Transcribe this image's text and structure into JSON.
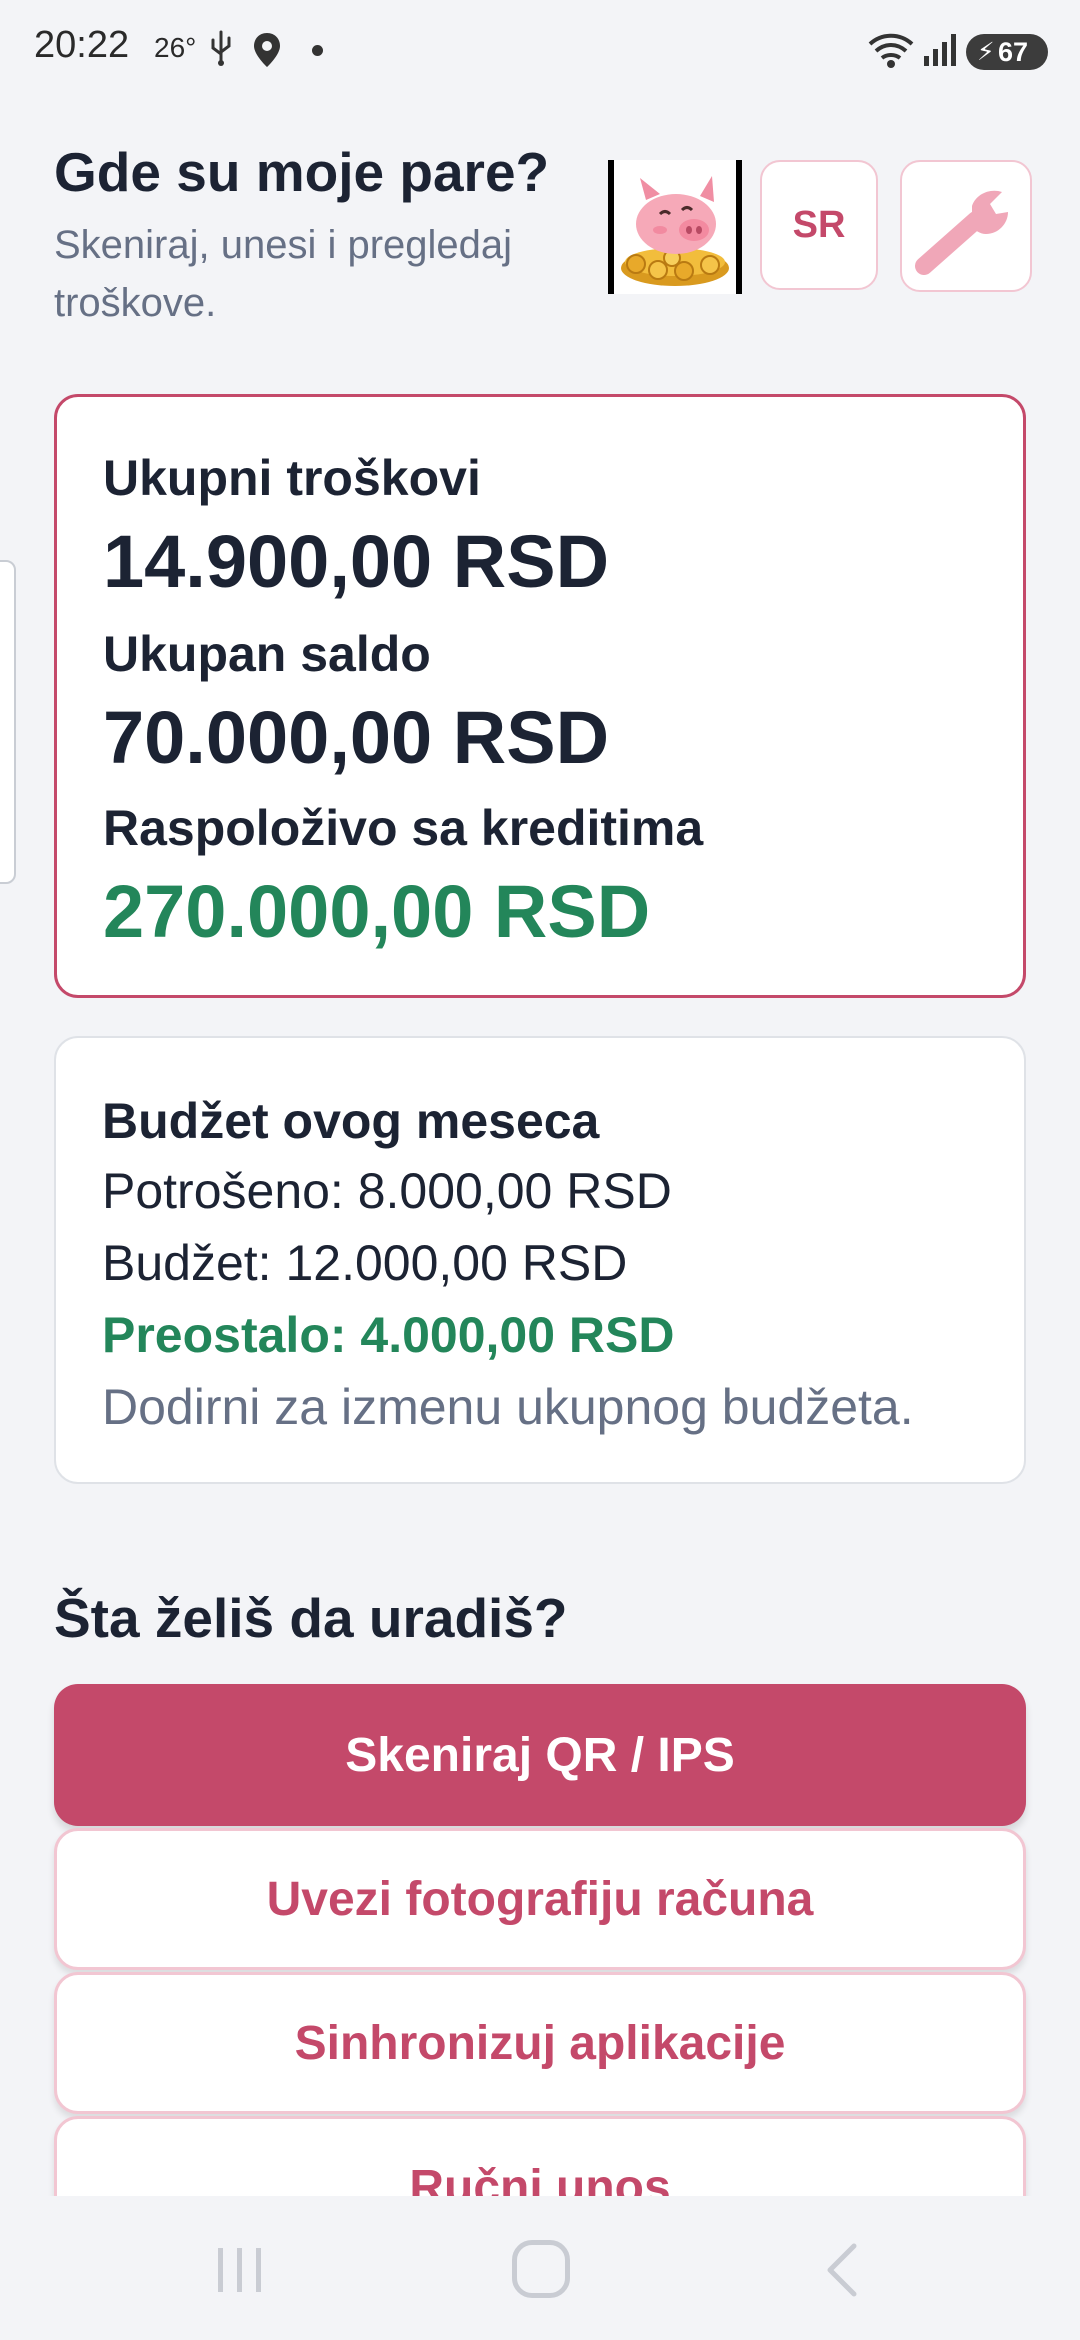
{
  "status_bar": {
    "time": "20:22",
    "temperature": "26°",
    "battery": "67",
    "icons": [
      "usb-icon",
      "location-icon",
      "wifi-icon",
      "signal-icon",
      "battery-charging-icon"
    ]
  },
  "header": {
    "title": "Gde su moje pare?",
    "subtitle": "Skeniraj, unesi i pregledaj troškove.",
    "language_button": "SR",
    "logo_icon": "piggy-bank-coins-icon",
    "settings_icon": "wrench-icon"
  },
  "summary": {
    "total_expenses_label": "Ukupni troškovi",
    "total_expenses_value": "14.900,00 RSD",
    "total_balance_label": "Ukupan saldo",
    "total_balance_value": "70.000,00 RSD",
    "available_label": "Raspoloživo sa kreditima",
    "available_value": "270.000,00 RSD"
  },
  "budget": {
    "title": "Budžet ovog meseca",
    "spent": "Potrošeno: 8.000,00 RSD",
    "budget": "Budžet: 12.000,00 RSD",
    "remaining": "Preostalo: 4.000,00 RSD",
    "hint": "Dodirni za izmenu ukupnog budžeta."
  },
  "actions": {
    "title": "Šta želiš da uradiš?",
    "scan": "Skeniraj QR / IPS",
    "import_photo": "Uvezi fotografiju računa",
    "sync": "Sinhronizuj aplikacije",
    "manual": "Ručni unos"
  },
  "colors": {
    "accent": "#c4496a",
    "accent_border": "#f2c6d2",
    "positive": "#23865a",
    "text": "#1c2333",
    "muted": "#667085",
    "background": "#f3f4f7"
  },
  "nav_bar": {
    "icons": [
      "recent-apps-icon",
      "home-icon",
      "back-icon"
    ]
  }
}
